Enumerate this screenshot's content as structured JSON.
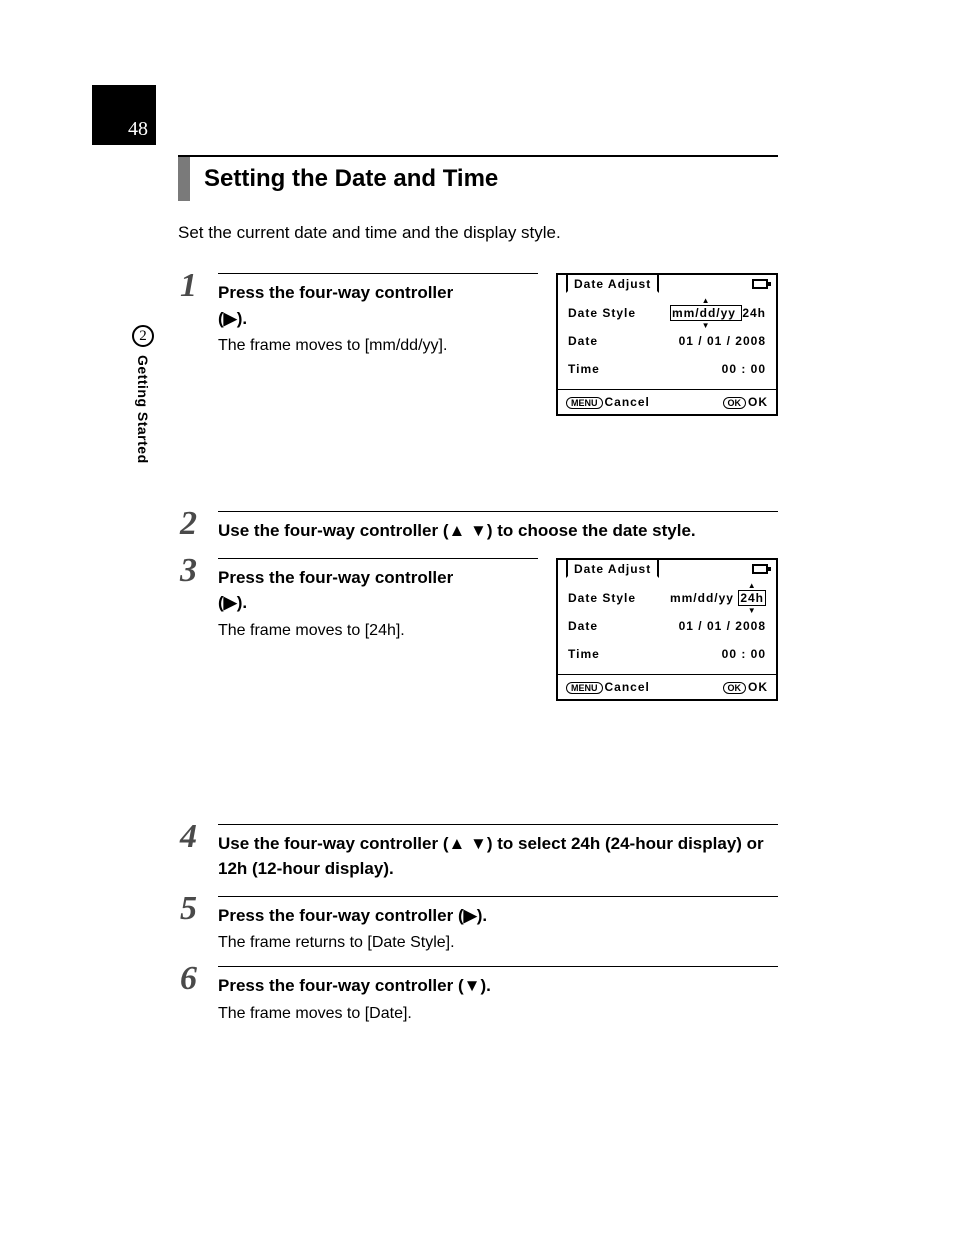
{
  "page_number": "48",
  "chapter_number": "2",
  "side_tab": "Getting Started",
  "section_title": "Setting the Date and Time",
  "intro": "Set the current date and time and the display style.",
  "glyphs": {
    "right": "▶",
    "up": "▲",
    "down": "▼"
  },
  "steps": {
    "s1": {
      "num": "1",
      "head_a": "Press the four-way controller",
      "head_b": "(",
      "head_c": ").",
      "sub": "The frame moves to [mm/dd/yy]."
    },
    "s2": {
      "num": "2",
      "head_a": "Use the four-way controller (",
      "head_b": ") to choose the date style."
    },
    "s3": {
      "num": "3",
      "head_a": "Press the four-way controller",
      "head_b": "(",
      "head_c": ").",
      "sub": "The frame moves to [24h]."
    },
    "s4": {
      "num": "4",
      "head_a": "Use the four-way controller (",
      "head_b": ") to select 24h (24-hour display) or 12h (12-hour display)."
    },
    "s5": {
      "num": "5",
      "head_a": "Press the four-way controller (",
      "head_b": ").",
      "sub": "The frame returns to [Date Style]."
    },
    "s6": {
      "num": "6",
      "head_a": "Press the four-way controller (",
      "head_b": ").",
      "sub": "The frame moves to [Date]."
    }
  },
  "lcd": {
    "title": "Date Adjust",
    "row_style": "Date Style",
    "row_date": "Date",
    "row_time": "Time",
    "val_style_fmt": "mm/dd/yy",
    "val_style_hr": "24h",
    "val_date": "01 / 01 / 2008",
    "val_time": "00 : 00",
    "menu_btn": "MENU",
    "cancel": "Cancel",
    "ok_btn": "OK",
    "ok": "OK"
  }
}
